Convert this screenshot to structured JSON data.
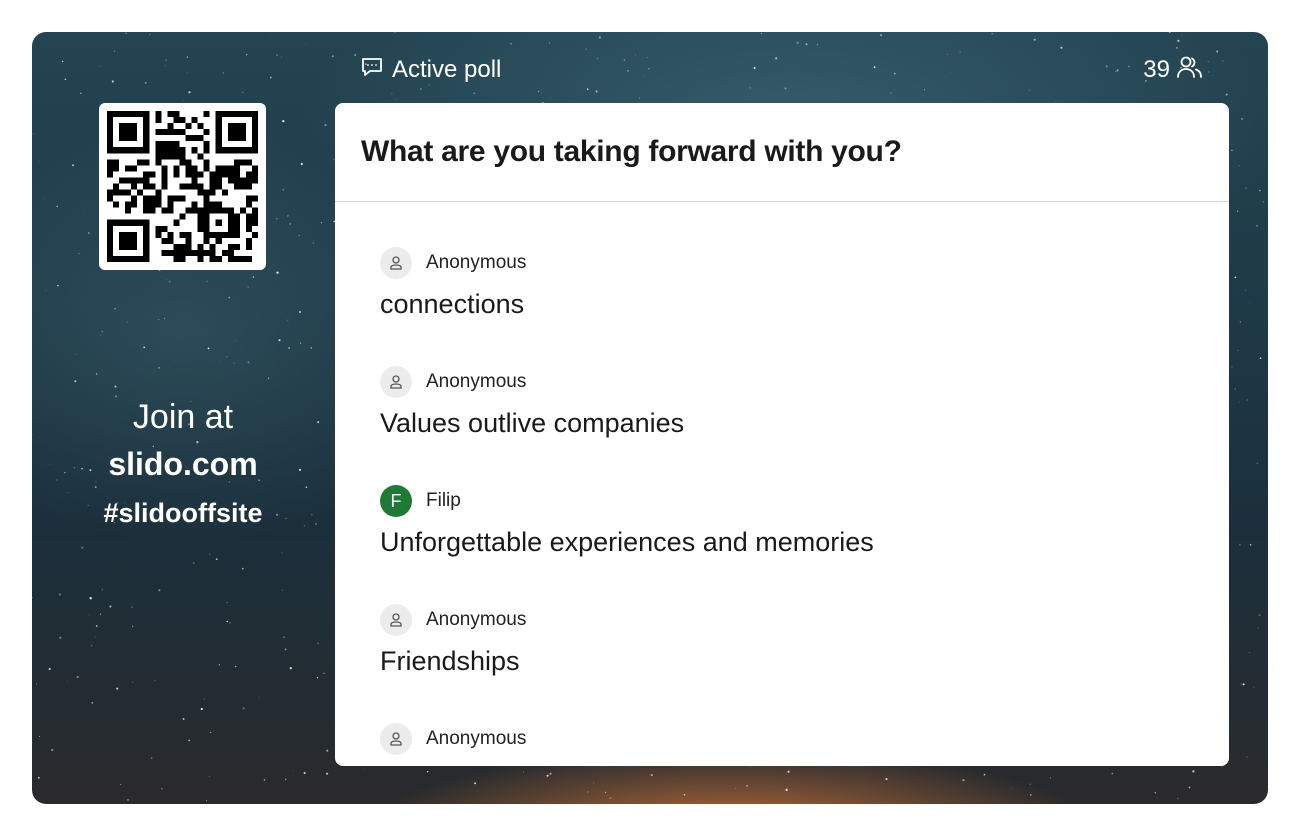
{
  "header": {
    "mode_label": "Active poll",
    "participant_count": "39",
    "mode_icon": "chat-bubble-icon",
    "participants_icon": "people-icon"
  },
  "join": {
    "line1": "Join at",
    "site": "slido.com",
    "event_code": "#slidooffsite"
  },
  "poll": {
    "question": "What are you taking forward with you?",
    "responses": [
      {
        "author": "Anonymous",
        "avatar": "person-icon",
        "text": "connections"
      },
      {
        "author": "Anonymous",
        "avatar": "person-icon",
        "text": "Values outlive companies"
      },
      {
        "author": "Filip",
        "avatar_letter": "F",
        "avatar_color": "#1f7a35",
        "text": "Unforgettable experiences and memories"
      },
      {
        "author": "Anonymous",
        "avatar": "person-icon",
        "text": "Friendships"
      },
      {
        "author": "Anonymous",
        "avatar": "person-icon",
        "text": ""
      }
    ]
  },
  "colors": {
    "card_background": "#ffffff",
    "accent_avatar": "#1f7a35",
    "text_primary": "#1a1a1a"
  }
}
